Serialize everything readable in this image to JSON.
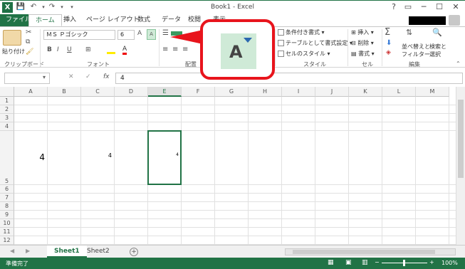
{
  "window": {
    "title": "Book1 - Excel",
    "minimize": "─",
    "maximize": "☐",
    "close": "✕",
    "restore": "?",
    "ribbon_toggle": "▭"
  },
  "quick_access": {
    "logo": "X",
    "save": "💾",
    "undo": "↶",
    "redo": "↷",
    "customize": "▾"
  },
  "tabs": [
    "ファイル",
    "ホーム",
    "挿入",
    "ページ レイアウト",
    "数式",
    "データ",
    "校閲",
    "表示"
  ],
  "ribbon": {
    "clipboard": {
      "paste_label": "貼り付け",
      "group_label": "クリップボード"
    },
    "font": {
      "name": "ＭＳ Ｐゴシック",
      "size": "6",
      "grow": "A",
      "shrink": "A",
      "bold": "B",
      "italic": "I",
      "underline": "U",
      "group_label": "フォント"
    },
    "alignment": {
      "group_label": "配置"
    },
    "styles": {
      "conditional": "条件付き書式",
      "table": "テーブルとして書式設定",
      "cell_styles": "セルのスタイル",
      "group_label": "スタイル"
    },
    "cells": {
      "insert": "挿入",
      "delete": "削除",
      "format": "書式",
      "group_label": "セル"
    },
    "editing": {
      "sort_filter_1": "並べ替えと",
      "sort_filter_2": "フィルター",
      "find_select_1": "検索と",
      "find_select_2": "選択",
      "group_label": "編集"
    }
  },
  "formula_bar": {
    "name_box": "",
    "fx": "fx",
    "content": "4",
    "cancel": "✕",
    "enter": "✓"
  },
  "columns": [
    "A",
    "B",
    "C",
    "D",
    "E",
    "F",
    "G",
    "H",
    "I",
    "J",
    "K",
    "L",
    "M"
  ],
  "selected_column": "E",
  "rows": [
    "1",
    "2",
    "3",
    "4",
    "5",
    "6",
    "7",
    "8",
    "9",
    "10",
    "11",
    "12"
  ],
  "cells": {
    "A5": "4",
    "C5": "4",
    "E5": "4"
  },
  "sheets": {
    "tabs": [
      "Sheet1",
      "Sheet2"
    ],
    "active": "Sheet1",
    "add": "+"
  },
  "status": {
    "ready": "準備完了",
    "zoom": "100%",
    "zoom_minus": "−",
    "zoom_plus": "+"
  },
  "callout": {
    "letter": "A",
    "icon": "font-shrink-icon"
  },
  "colors": {
    "accent": "#217346",
    "callout_border": "#e8141c",
    "callout_fill": "#cfead7"
  }
}
